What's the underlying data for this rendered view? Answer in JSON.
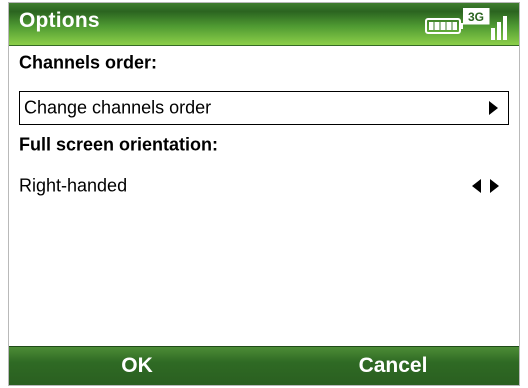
{
  "header": {
    "title": "Options",
    "status_icons": [
      "battery-icon",
      "3g-signal-icon"
    ],
    "network_label": "3G"
  },
  "sections": {
    "channels_order_label": "Channels order:",
    "channels_order_value": "Change channels order",
    "orientation_label": "Full screen orientation:",
    "orientation_value": "Right-handed"
  },
  "softkeys": {
    "left": "OK",
    "right": "Cancel"
  },
  "colors": {
    "titlebar_green": "#2b6420",
    "titlebar_light_green": "#8ccf49",
    "softbar_green": "#2f6a24",
    "text": "#000000"
  }
}
